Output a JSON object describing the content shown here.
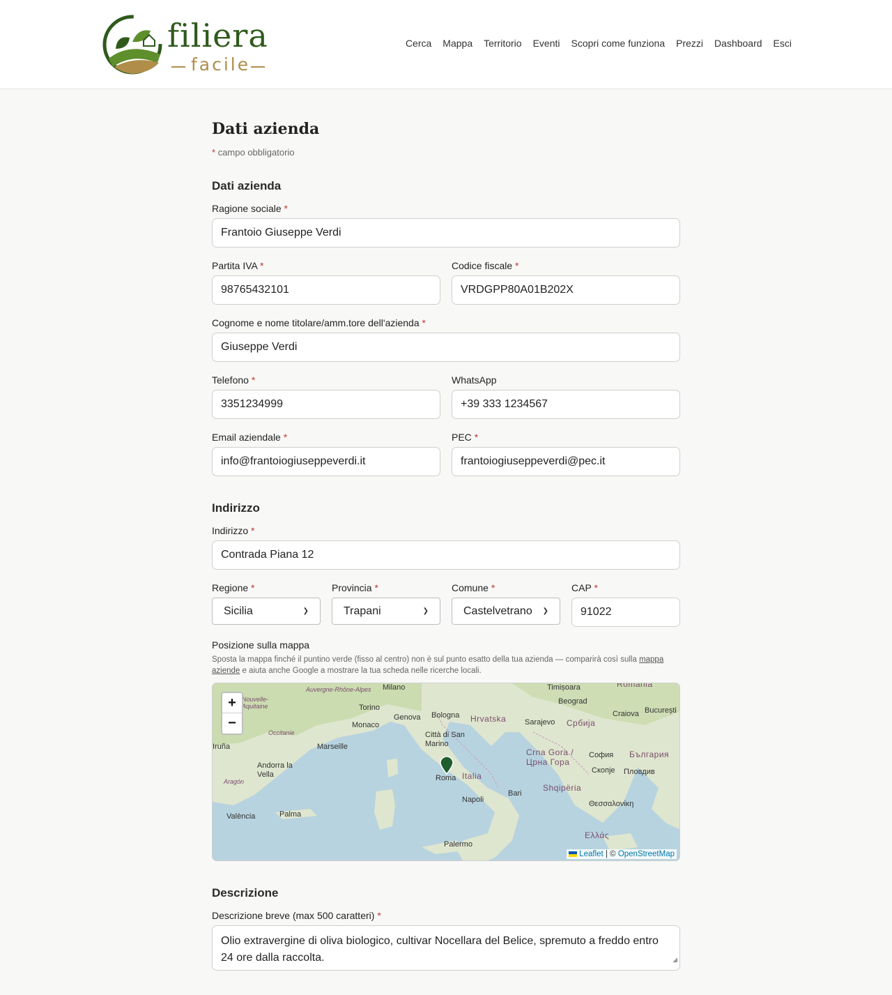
{
  "logo": {
    "word1": "filiera",
    "word2": "facile"
  },
  "nav": [
    "Cerca",
    "Mappa",
    "Territorio",
    "Eventi",
    "Scopri come funziona",
    "Prezzi",
    "Dashboard",
    "Esci"
  ],
  "page": {
    "title": "Dati azienda",
    "required_note": "campo obbligatorio",
    "required_mark": "*"
  },
  "sections": {
    "company": "Dati azienda",
    "address": "Indirizzo",
    "description": "Descrizione"
  },
  "fields": {
    "ragione_sociale": {
      "label": "Ragione sociale",
      "value": "Frantoio Giuseppe Verdi"
    },
    "partita_iva": {
      "label": "Partita IVA",
      "value": "98765432101"
    },
    "codice_fiscale": {
      "label": "Codice fiscale",
      "value": "VRDGPP80A01B202X"
    },
    "titolare": {
      "label": "Cognome e nome titolare/amm.tore dell'azienda",
      "value": "Giuseppe Verdi"
    },
    "telefono": {
      "label": "Telefono",
      "value": "3351234999"
    },
    "whatsapp": {
      "label": "WhatsApp",
      "value": "+39 333 1234567"
    },
    "email": {
      "label": "Email aziendale",
      "value": "info@frantoiogiuseppeverdi.it"
    },
    "pec": {
      "label": "PEC",
      "value": "frantoiogiuseppeverdi@pec.it"
    },
    "indirizzo": {
      "label": "Indirizzo",
      "value": "Contrada Piana 12"
    },
    "regione": {
      "label": "Regione",
      "value": "Sicilia"
    },
    "provincia": {
      "label": "Provincia",
      "value": "Trapani"
    },
    "comune": {
      "label": "Comune",
      "value": "Castelvetrano"
    },
    "cap": {
      "label": "CAP",
      "value": "91022"
    },
    "descrizione": {
      "label": "Descrizione breve (max 500 caratteri)",
      "value": "Olio extravergine di oliva biologico, cultivar Nocellara del Belice, spremuto a freddo entro 24 ore dalla raccolta."
    }
  },
  "map": {
    "label": "Posizione sulla mappa",
    "help_before": "Sposta la mappa finché il puntino verde (fisso al centro) non è sul punto esatto della tua azienda — comparirà così sulla",
    "help_link": "mappa aziende",
    "help_after": "e aiuta anche Google a mostrare la tua scheda nelle ricerche locali.",
    "zoom_in": "+",
    "zoom_out": "−",
    "attribution_leaflet": "Leaflet",
    "attribution_sep": "| ©",
    "attribution_osm": "OpenStreetMap",
    "places": [
      "Auvergne-Rhône-Alpes",
      "Milano",
      "Timișoara",
      "România",
      "Nouvelle-Aquitaine",
      "Torino",
      "Genova",
      "Bologna",
      "Hrvatska",
      "Beograd",
      "Craiova",
      "București",
      "Occitanie",
      "Monaco",
      "Città di San Marino",
      "Sarajevo",
      "Србија",
      "Iruña",
      "Marseille",
      "Andorra la Vella",
      "Roma",
      "Italia",
      "Crna Gora / Црна Гора",
      "София",
      "България",
      "Aragón",
      "Скопје",
      "Пловдив",
      "Shqipëria",
      "Bari",
      "València",
      "Palma",
      "Napoli",
      "Θεσσαλονίκη",
      "Ελλάς",
      "Palermo"
    ],
    "colors": {
      "sea": "#b7d3df",
      "land": "#dfe6cf",
      "forest": "#c6d9a8",
      "marker": "#1f5c2e"
    }
  }
}
